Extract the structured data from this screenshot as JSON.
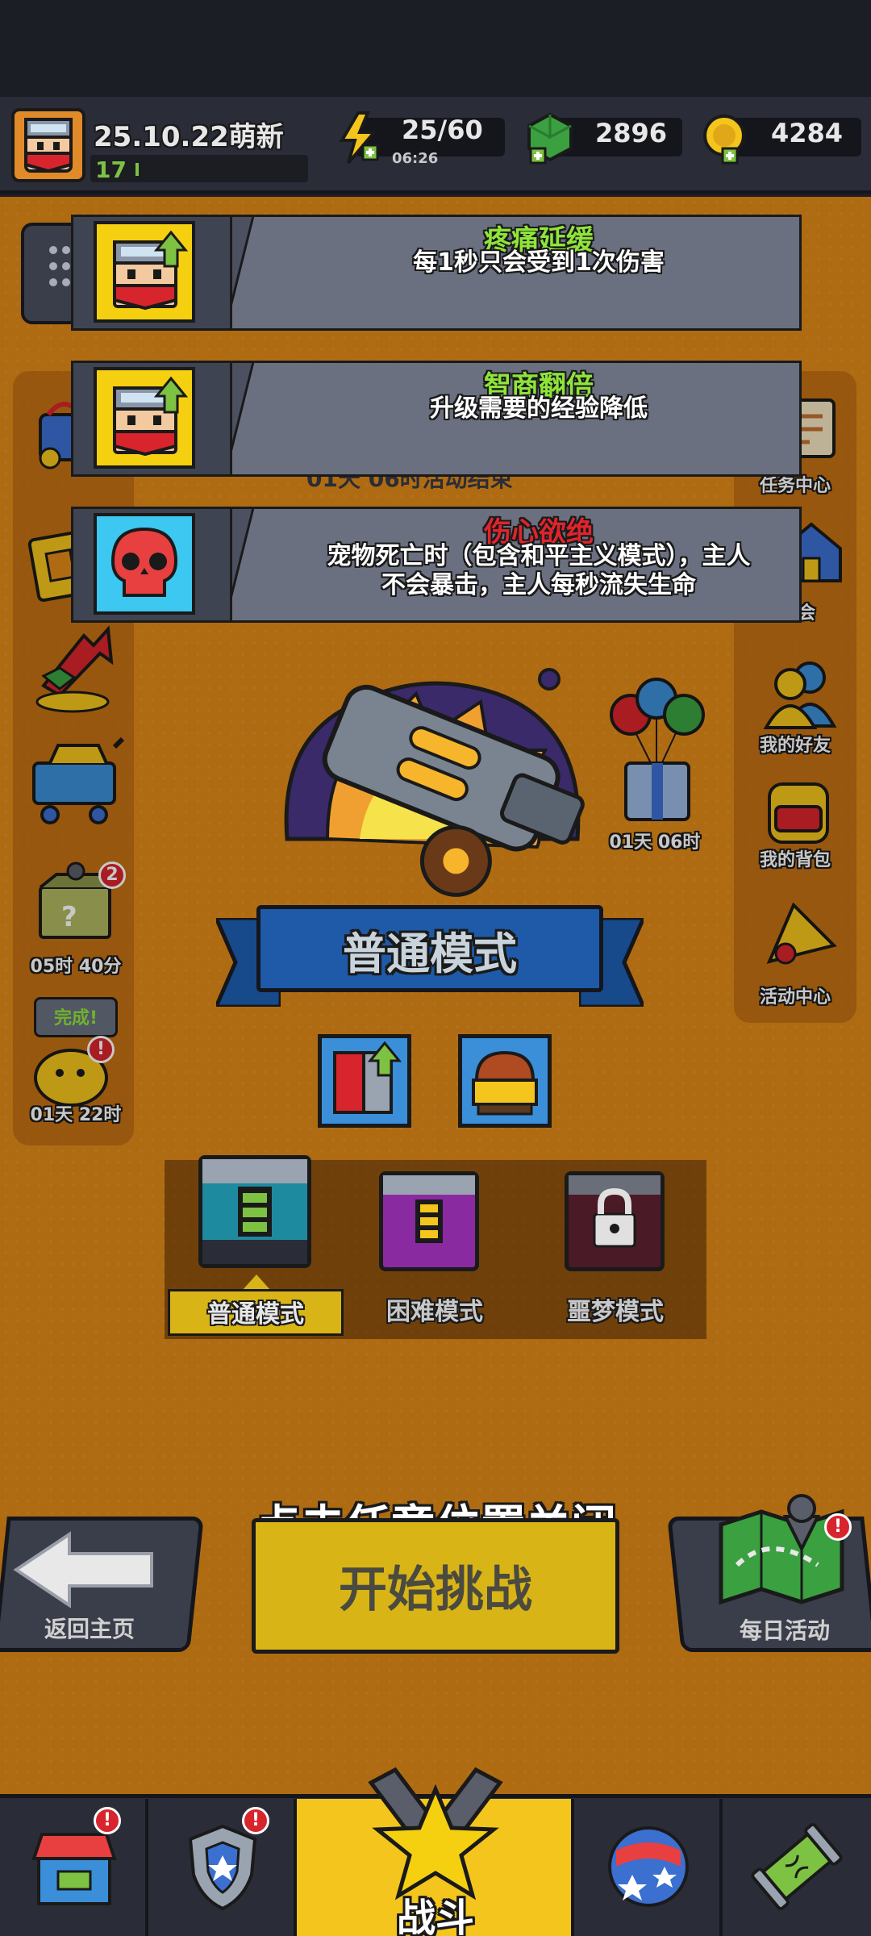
{
  "player": {
    "name": "25.10.22萌新",
    "level": "17"
  },
  "resources": {
    "energy": {
      "value": "25/60",
      "timer": "06:26",
      "icon": "lightning-icon"
    },
    "gems": {
      "value": "2896",
      "icon": "gem-icon"
    },
    "coins": {
      "value": "4284",
      "icon": "coin-icon"
    }
  },
  "buffs": [
    {
      "title": "疼痛延缓",
      "desc": "每1秒只会受到1次伤害",
      "title_color": "#8fe43a",
      "icon": "hero-upgrade-icon"
    },
    {
      "title": "智商翻倍",
      "desc": "升级需要的经验降低",
      "title_color": "#8fe43a",
      "icon": "hero-upgrade-icon"
    },
    {
      "title": "伤心欲绝",
      "desc_line1": "宠物死亡时（包含和平主义模式），主人",
      "desc_line2": "不会暴击，主人每秒流失生命",
      "title_color": "#e0242c",
      "icon": "skull-icon"
    }
  ],
  "left_side": {
    "chest_timer": "05时 40分",
    "chest_badge": "2",
    "pet_done": "完成!",
    "pet_timer": "01天 22时"
  },
  "right_side": {
    "task_center": "任务中心",
    "partial_label": "会",
    "friends": "我的好友",
    "backpack": "我的背包",
    "events": "活动中心",
    "gift_timer": "01天 06时"
  },
  "hidden_text": "01天 06时活动结束",
  "mode_banner": "普通模式",
  "modes": {
    "normal": "普通模式",
    "hard": "困难模式",
    "nightmare": "噩梦模式",
    "selected": "普通模式"
  },
  "overlay_hint": "点击任意位置关闭",
  "buttons": {
    "back": "返回主页",
    "start": "开始挑战",
    "daily": "每日活动"
  },
  "bottom_nav": {
    "battle": "战斗"
  },
  "colors": {
    "background": "#e08a18",
    "hud": "#2a2d38",
    "start_button": "#d8b416",
    "selected_tab": "#d8b416",
    "banner": "#1e5aa8"
  }
}
